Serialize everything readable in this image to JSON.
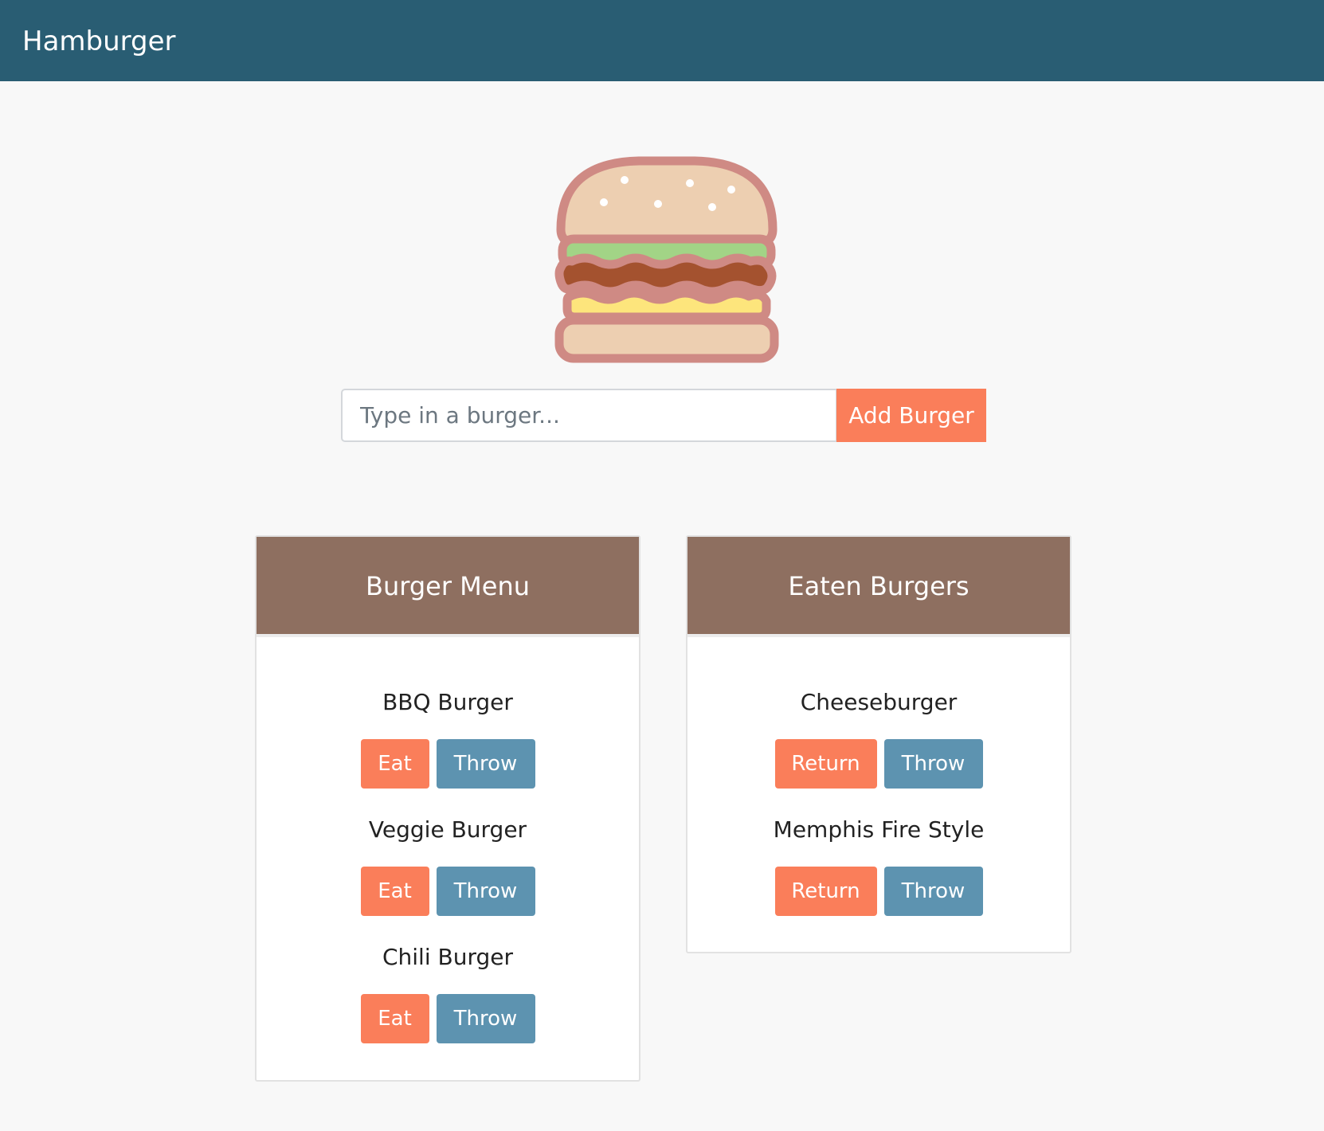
{
  "navbar": {
    "brand": "Hamburger"
  },
  "logo": {
    "icon": "hamburger-icon"
  },
  "form": {
    "placeholder": "Type in a burger...",
    "value": "",
    "add_label": "Add Burger"
  },
  "menu": {
    "title": "Burger Menu",
    "items": [
      {
        "name": "BBQ Burger",
        "eat": "Eat",
        "throw": "Throw"
      },
      {
        "name": "Veggie Burger",
        "eat": "Eat",
        "throw": "Throw"
      },
      {
        "name": "Chili Burger",
        "eat": "Eat",
        "throw": "Throw"
      }
    ]
  },
  "eaten": {
    "title": "Eaten Burgers",
    "items": [
      {
        "name": "Cheeseburger",
        "return": "Return",
        "throw": "Throw"
      },
      {
        "name": "Memphis Fire Style",
        "return": "Return",
        "throw": "Throw"
      }
    ]
  },
  "colors": {
    "navbar": "#295d73",
    "accent_orange": "#fa7e5a",
    "accent_blue": "#5d93b0",
    "panel_header": "#8e6f60",
    "background": "#f8f8f8"
  }
}
